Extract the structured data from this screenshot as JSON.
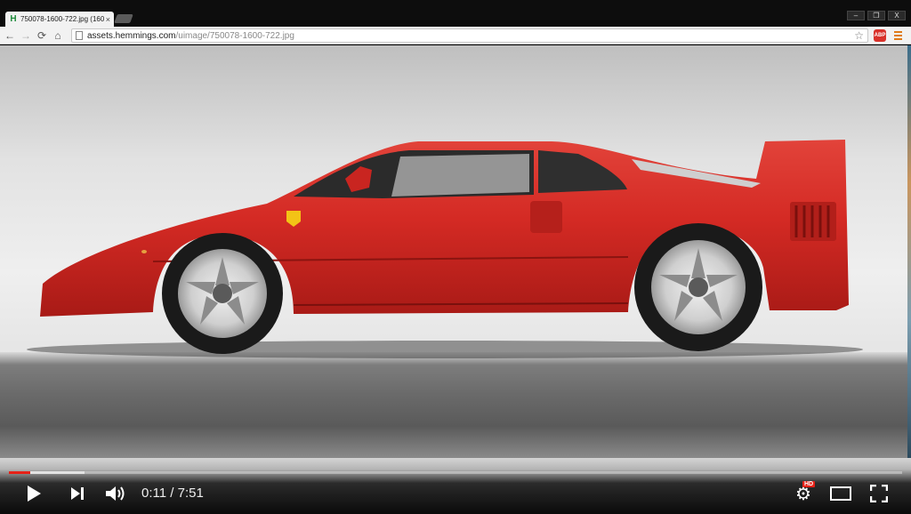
{
  "browser": {
    "tab_title": "750078-1600-722.jpg (160",
    "tab_favicon": "H",
    "url_host": "assets.hemmings.com",
    "url_path": "/uimage/750078-1600-722.jpg",
    "window_controls": [
      "–",
      "❐",
      "X"
    ],
    "extension_label": "ABP"
  },
  "player": {
    "current_time": "0:11",
    "separator": " / ",
    "duration": "7:51",
    "progress_played_fraction": 0.024,
    "progress_buffered_fraction": 0.085,
    "hd_label": "HD"
  },
  "colors": {
    "accent_red": "#e62117",
    "car_red": "#d42a24",
    "favicon_green": "#1e8a3a"
  }
}
